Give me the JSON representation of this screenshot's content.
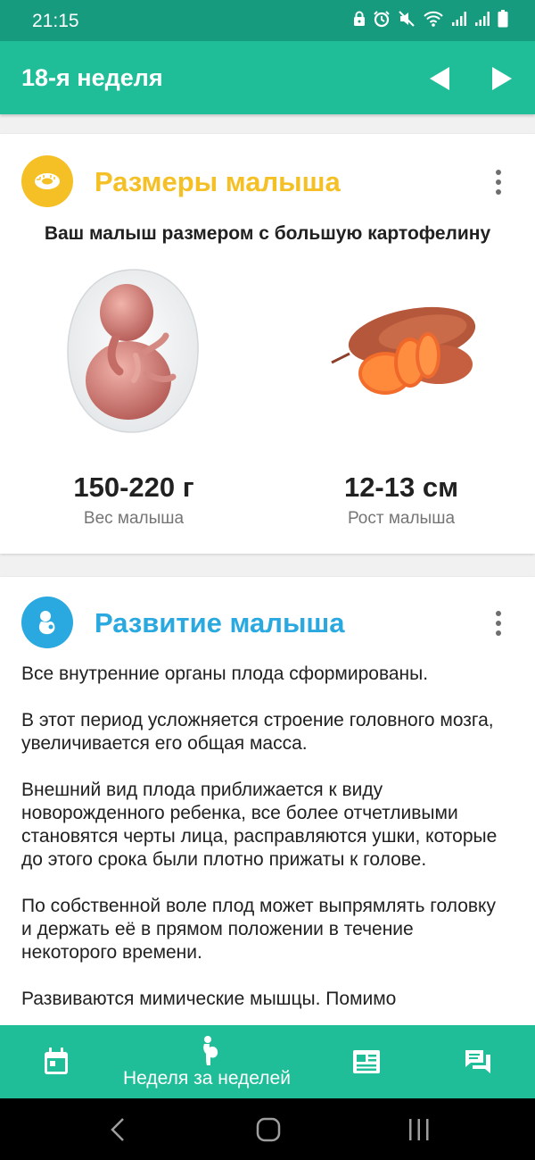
{
  "status_bar": {
    "time": "21:15",
    "icons": [
      "lock-icon",
      "alarm-icon",
      "mute-icon",
      "wifi-icon",
      "signal-icon",
      "signal-icon",
      "battery-icon"
    ]
  },
  "toolbar": {
    "title": "18-я неделя",
    "prev_icon": "triangle-left-icon",
    "next_icon": "triangle-right-icon"
  },
  "size_card": {
    "title": "Размеры малыша",
    "title_color": "#f5c026",
    "icon": "measuring-tape-icon",
    "description": "Ваш малыш размером с большую картофелину",
    "weight_value": "150-220 г",
    "weight_label": "Вес малыша",
    "height_value": "12-13 см",
    "height_label": "Рост малыша"
  },
  "dev_card": {
    "title": "Развитие малыша",
    "title_color": "#2aa9e0",
    "icon": "fetus-icon",
    "paragraphs": [
      "Все внутренние органы плода сформированы.",
      "В этот период усложняется строение головного мозга, увеличивается его общая масса.",
      "Внешний вид плода приближается к виду новорожденного ребенка, все более отчетливыми становятся черты лица, расправляются ушки, которые до этого срока были плотно прижаты к голове.",
      "По собственной воле плод может выпрямлять головку и держать её в прямом положении в течение некоторого времени.",
      "Развиваются мимические мышцы. Помимо"
    ]
  },
  "bottom_nav": {
    "items": [
      {
        "icon": "calendar-icon"
      },
      {
        "icon": "pregnancy-icon",
        "label": "Неделя за неделей",
        "active": true
      },
      {
        "icon": "article-icon"
      },
      {
        "icon": "chat-icon"
      }
    ]
  },
  "colors": {
    "accent": "#20bd99",
    "status_bar": "#179b7f"
  }
}
